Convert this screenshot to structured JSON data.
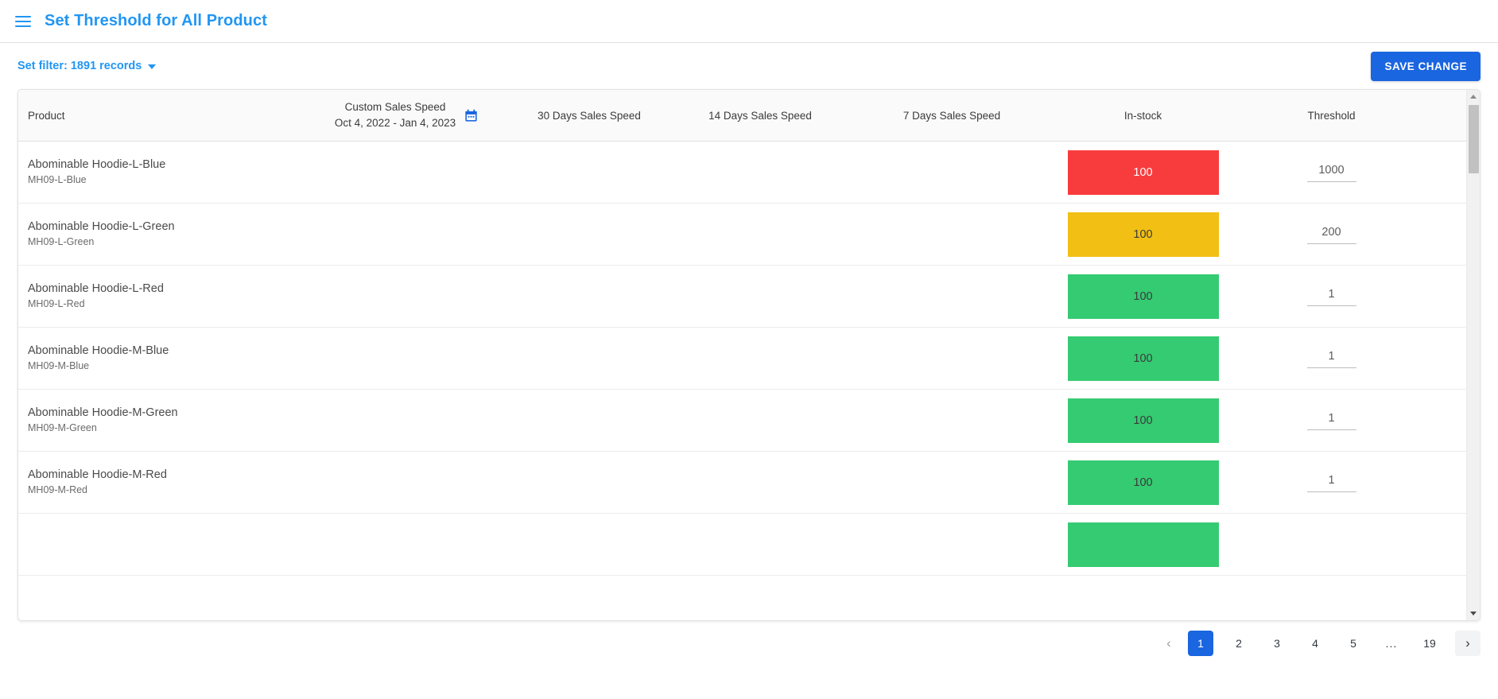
{
  "appbar": {
    "menu_icon": "hamburger-menu-icon",
    "title": "Set Threshold for All Product",
    "title_color": "#2196f3"
  },
  "filterbar": {
    "filter_label": "Set filter: 1891 records",
    "filter_caret_icon": "chevron-down-icon",
    "save_label": "SAVE CHANGE",
    "save_color": "#1a65e0"
  },
  "table": {
    "columns": {
      "product": "Product",
      "custom_sales_speed": "Custom Sales Speed",
      "custom_date_range": "Oct 4, 2022 - Jan 4, 2023",
      "calendar_icon": "calendar-icon",
      "days_30": "30 Days Sales Speed",
      "days_14": "14 Days Sales Speed",
      "days_7": "7 Days Sales Speed",
      "in_stock": "In-stock",
      "threshold": "Threshold"
    },
    "status_colors": {
      "red": "#f83c3e",
      "yellow": "#f2c014",
      "green": "#35cb72"
    },
    "rows": [
      {
        "name": "Abominable Hoodie-L-Blue",
        "sku": "MH09-L-Blue",
        "custom_sales_speed": "",
        "days_30": "",
        "days_14": "",
        "days_7": "",
        "in_stock": "100",
        "stock_level": "red",
        "threshold": "1000"
      },
      {
        "name": "Abominable Hoodie-L-Green",
        "sku": "MH09-L-Green",
        "custom_sales_speed": "",
        "days_30": "",
        "days_14": "",
        "days_7": "",
        "in_stock": "100",
        "stock_level": "yellow",
        "threshold": "200"
      },
      {
        "name": "Abominable Hoodie-L-Red",
        "sku": "MH09-L-Red",
        "custom_sales_speed": "",
        "days_30": "",
        "days_14": "",
        "days_7": "",
        "in_stock": "100",
        "stock_level": "green",
        "threshold": "1"
      },
      {
        "name": "Abominable Hoodie-M-Blue",
        "sku": "MH09-M-Blue",
        "custom_sales_speed": "",
        "days_30": "",
        "days_14": "",
        "days_7": "",
        "in_stock": "100",
        "stock_level": "green",
        "threshold": "1"
      },
      {
        "name": "Abominable Hoodie-M-Green",
        "sku": "MH09-M-Green",
        "custom_sales_speed": "",
        "days_30": "",
        "days_14": "",
        "days_7": "",
        "in_stock": "100",
        "stock_level": "green",
        "threshold": "1"
      },
      {
        "name": "Abominable Hoodie-M-Red",
        "sku": "MH09-M-Red",
        "custom_sales_speed": "",
        "days_30": "",
        "days_14": "",
        "days_7": "",
        "in_stock": "100",
        "stock_level": "green",
        "threshold": "1"
      },
      {
        "name": "",
        "sku": "",
        "custom_sales_speed": "",
        "days_30": "",
        "days_14": "",
        "days_7": "",
        "in_stock": "",
        "stock_level": "green",
        "threshold": ""
      }
    ]
  },
  "scrollbar": {
    "up_icon": "scroll-up-arrow-icon",
    "down_icon": "scroll-down-arrow-icon"
  },
  "pagination": {
    "prev_icon": "chevron-left-icon",
    "next_icon": "chevron-right-icon",
    "pages": [
      "1",
      "2",
      "3",
      "4",
      "5"
    ],
    "ellipsis": "...",
    "last_page": "19",
    "active_page": "1"
  }
}
